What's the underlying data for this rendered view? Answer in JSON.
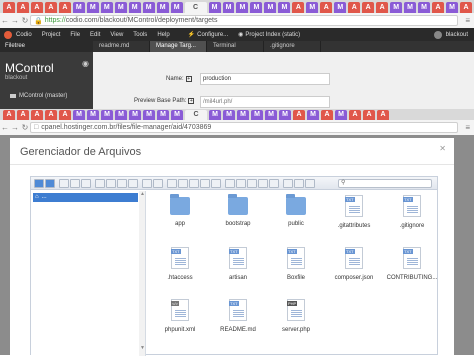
{
  "browser_top": {
    "tab_icons": [
      "A",
      "A",
      "A",
      "A",
      "A",
      "M",
      "M",
      "M",
      "M",
      "M",
      "M",
      "M",
      "M",
      "M",
      "M",
      "M",
      "M",
      "M",
      "M",
      "A",
      "M",
      "A",
      "M",
      "A",
      "A",
      "A",
      "M",
      "M",
      "M",
      "A",
      "M",
      "A"
    ],
    "active_tab_label": "C",
    "url_prefix": "https://",
    "url": "codio.com/blackout/MControl/deployment/targets"
  },
  "codio": {
    "menu": [
      "Codio",
      "Project",
      "File",
      "Edit",
      "View",
      "Tools",
      "Help"
    ],
    "menu_right": [
      "Configure...",
      "Project Index (static)"
    ],
    "user": "blackout",
    "filetree_label": "Filetree",
    "project_name": "MControl",
    "project_owner": "blackout",
    "tree_item": "MControl (master)",
    "tabs": [
      "readme.md",
      "Manage Targ...",
      "Terminal",
      ".gitignore"
    ],
    "form": {
      "name_label": "Name:",
      "name_value": "production",
      "preview_label": "Preview Base Path:",
      "preview_value": "/mil4url.ph/"
    }
  },
  "browser_bottom": {
    "active_tab_label": "C",
    "url": "cpanel.hostinger.com.br/files/file-manager/aid/4703869"
  },
  "file_manager": {
    "title": "Gerenciador de Arquivos",
    "tree_root": "...",
    "files": [
      {
        "name": "app",
        "type": "folder"
      },
      {
        "name": "bootstrap",
        "type": "folder"
      },
      {
        "name": "public",
        "type": "folder"
      },
      {
        "name": ".gitattributes",
        "type": "txt"
      },
      {
        "name": ".gitignore",
        "type": "txt"
      },
      {
        "name": ".htaccess",
        "type": "txt"
      },
      {
        "name": "artisan",
        "type": "txt"
      },
      {
        "name": "Boxfile",
        "type": "txt"
      },
      {
        "name": "composer.json",
        "type": "txt"
      },
      {
        "name": "CONTRIBUTING...",
        "type": "txt"
      },
      {
        "name": "phpunit.xml",
        "type": "xml"
      },
      {
        "name": "README.md",
        "type": "txt"
      },
      {
        "name": "server.php",
        "type": "php"
      }
    ],
    "icon_badges": {
      "txt": "TXT",
      "xml": "</>",
      "php": "PHP"
    }
  }
}
